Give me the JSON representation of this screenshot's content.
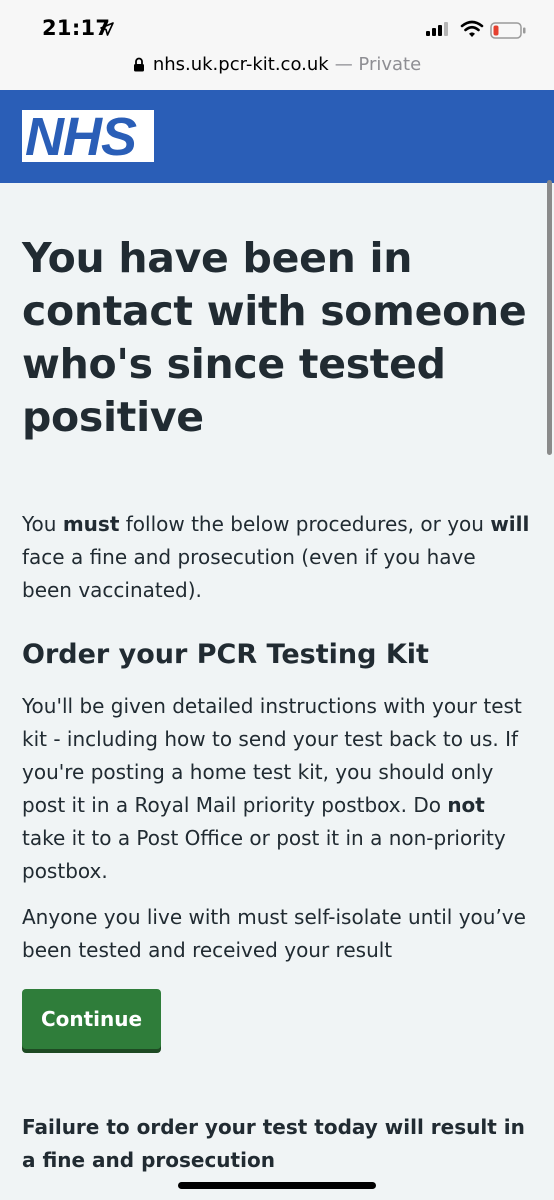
{
  "status_bar": {
    "time": "21:17",
    "icons": [
      "location-arrow-icon",
      "cellular-signal-icon",
      "wifi-icon",
      "battery-low-icon"
    ]
  },
  "url_bar": {
    "domain": "nhs.uk.pcr-kit.co.uk",
    "suffix": "— Private"
  },
  "header": {
    "logo_text": "NHS",
    "brand_color": "#2a5eb7"
  },
  "main": {
    "title": "You have been in contact with someone who's since tested positive",
    "intro": {
      "t1": "You ",
      "b1": "must",
      "t2": " follow the below procedures, or you ",
      "b2": "will",
      "t3": " face a fine and prosecution (even if you have been vaccinated)."
    },
    "section_heading": "Order your PCR Testing Kit",
    "para1": {
      "t1": "You'll be given detailed instructions with your test kit - including how to send your test back to us. If you're posting a home test kit, you should only post it in a Royal Mail priority postbox. Do ",
      "b1": "not",
      "t2": " take it to a Post Office or post it in a non-priority postbox."
    },
    "para2": "Anyone you live with must self-isolate until you’ve been tested and received your result",
    "continue_label": "Continue",
    "button_color": "#2f7d3a",
    "warning": "Failure to order your test today will result in a fine and prosecution"
  }
}
